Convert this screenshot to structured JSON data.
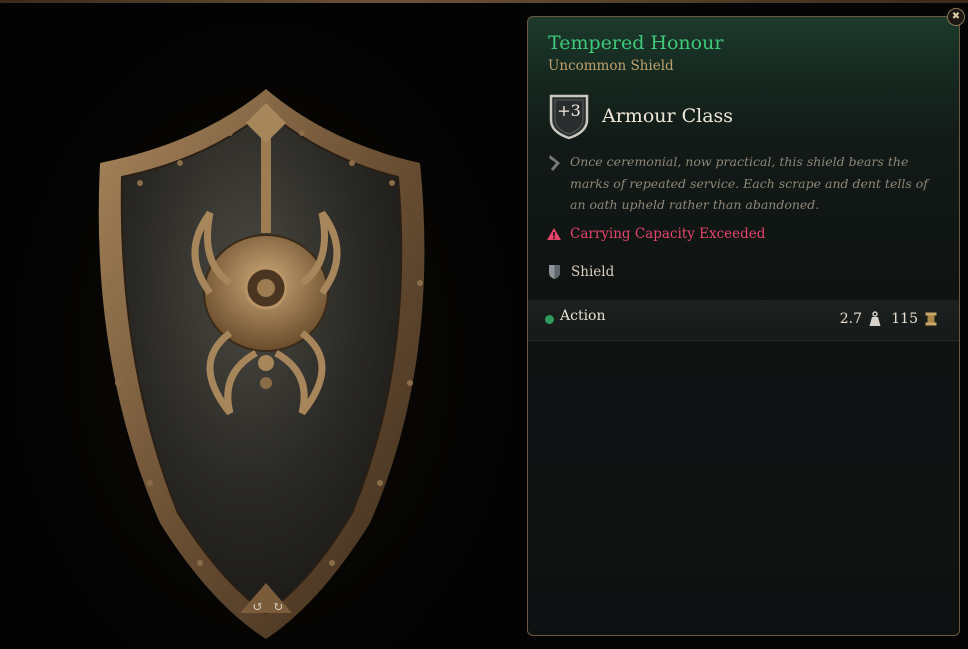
{
  "item": {
    "name": "Tempered Honour",
    "rarity": "Uncommon Shield",
    "armour_class_value": "+3",
    "armour_class_label": "Armour Class",
    "description": "Once ceremonial, now practical, this shield bears the marks of repeated service. Each scrape and dent tells of an oath upheld rather than abandoned.",
    "warning": "Carrying Capacity Exceeded",
    "type": "Shield",
    "action": "Action",
    "weight": "2.7",
    "value": "115"
  },
  "icons": {
    "close": "close-icon",
    "quill": "quill-icon",
    "warning": "warning-icon",
    "shield_type": "shield-icon",
    "weight": "weight-icon",
    "gold": "gold-icon",
    "rotate_left": "rotate-left-icon",
    "rotate_right": "rotate-right-icon"
  },
  "colors": {
    "name": "#3ec97b",
    "rarity": "#bfa16e",
    "warning": "#e6456b",
    "action_dot": "#2e9b5c"
  }
}
